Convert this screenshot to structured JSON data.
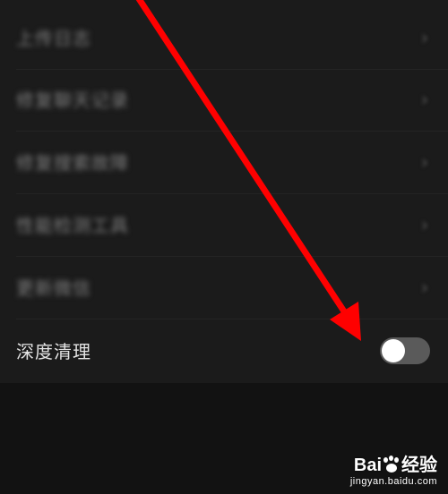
{
  "settings": {
    "items": [
      {
        "label": "上传日志",
        "chevron": "›"
      },
      {
        "label": "修复聊天记录",
        "chevron": "›"
      },
      {
        "label": "修复搜索故障",
        "chevron": "›"
      },
      {
        "label": "性能检测工具",
        "chevron": "›"
      },
      {
        "label": "更新微信",
        "chevron": "›"
      }
    ],
    "deep_clean": {
      "label": "深度清理",
      "toggle_on": false
    }
  },
  "annotation": {
    "arrow_color": "#ff0000"
  },
  "watermark": {
    "brand_left": "Bai",
    "brand_right": "经验",
    "url": "jingyan.baidu.com"
  },
  "icons": {
    "chevron": "chevron-right-icon",
    "paw": "baidu-paw-icon"
  }
}
